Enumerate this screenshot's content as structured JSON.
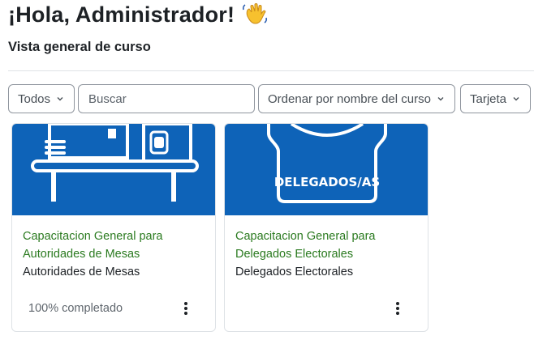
{
  "header": {
    "greeting": "¡Hola, Administrador!",
    "wave_icon": "waving-hand-emoji"
  },
  "overview": {
    "title": "Vista general de curso"
  },
  "controls": {
    "filter_label": "Todos",
    "search_placeholder": "Buscar",
    "sort_label": "Ordenar por nombre del curso",
    "view_label": "Tarjeta"
  },
  "courses": [
    {
      "name": "Capacitacion General para Autoridades de Mesas",
      "category": "Autoridades de Mesas",
      "progress_text": "100% completado",
      "progress_percent": 100,
      "image_text": ""
    },
    {
      "name": "Capacitacion General para Delegados Electorales",
      "category": "Delegados Electorales",
      "progress_text": "",
      "image_text": "DELEGADOS/AS"
    }
  ],
  "colors": {
    "course_image_bg": "#0e63b8",
    "course_link": "#2a7a1f",
    "text": "#1d2125",
    "border": "#8f959e"
  }
}
